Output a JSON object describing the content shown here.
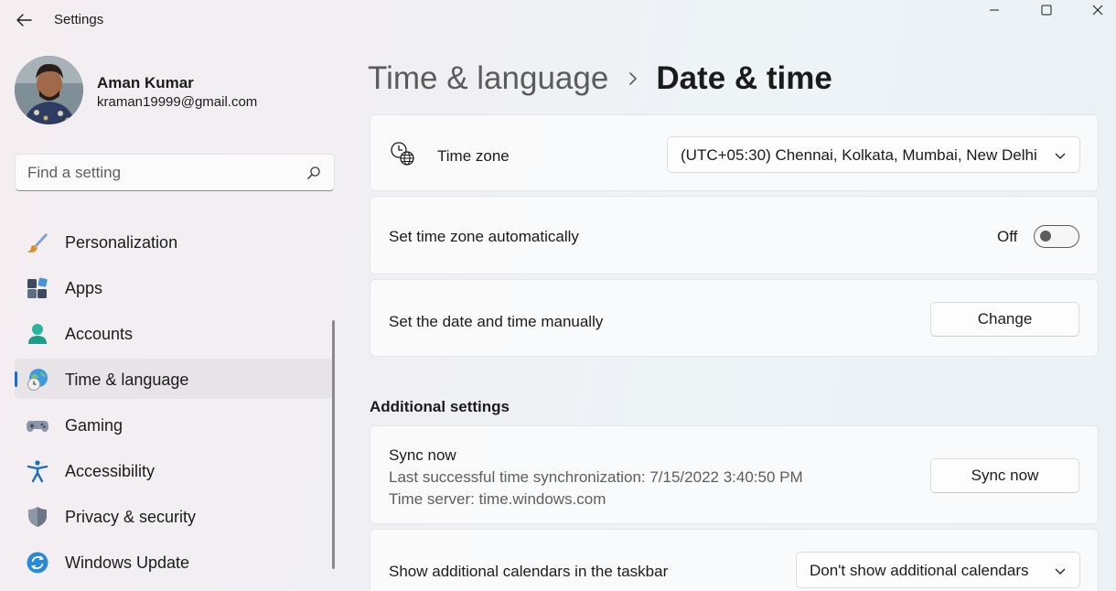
{
  "window": {
    "title": "Settings",
    "controls": {
      "minimize": "minimize-icon",
      "maximize": "maximize-icon",
      "close": "close-icon"
    }
  },
  "profile": {
    "name": "Aman Kumar",
    "email": "kraman19999@gmail.com"
  },
  "search": {
    "placeholder": "Find a setting"
  },
  "sidebar": {
    "items": [
      {
        "label": "Personalization",
        "icon": "paintbrush-icon"
      },
      {
        "label": "Apps",
        "icon": "apps-icon"
      },
      {
        "label": "Accounts",
        "icon": "person-icon"
      },
      {
        "label": "Time & language",
        "icon": "globe-clock-icon",
        "active": true
      },
      {
        "label": "Gaming",
        "icon": "gamepad-icon"
      },
      {
        "label": "Accessibility",
        "icon": "accessibility-icon"
      },
      {
        "label": "Privacy & security",
        "icon": "shield-icon"
      },
      {
        "label": "Windows Update",
        "icon": "update-icon"
      }
    ]
  },
  "breadcrumb": {
    "parent": "Time & language",
    "current": "Date & time"
  },
  "main": {
    "time_zone": {
      "label": "Time zone",
      "value": "(UTC+05:30) Chennai, Kolkata, Mumbai, New Delhi"
    },
    "auto_time_zone": {
      "label": "Set time zone automatically",
      "state_text": "Off",
      "enabled": false
    },
    "manual": {
      "label": "Set the date and time manually",
      "button": "Change"
    },
    "additional_settings_title": "Additional settings",
    "sync": {
      "title": "Sync now",
      "last_sync": "Last successful time synchronization: 7/15/2022 3:40:50 PM",
      "server": "Time server: time.windows.com",
      "button": "Sync now"
    },
    "calendars": {
      "label": "Show additional calendars in the taskbar",
      "value": "Don't show additional calendars"
    }
  },
  "colors": {
    "accent": "#1a6fc9",
    "text": "#1b1b1b",
    "secondary_text": "#5d5d5d"
  }
}
